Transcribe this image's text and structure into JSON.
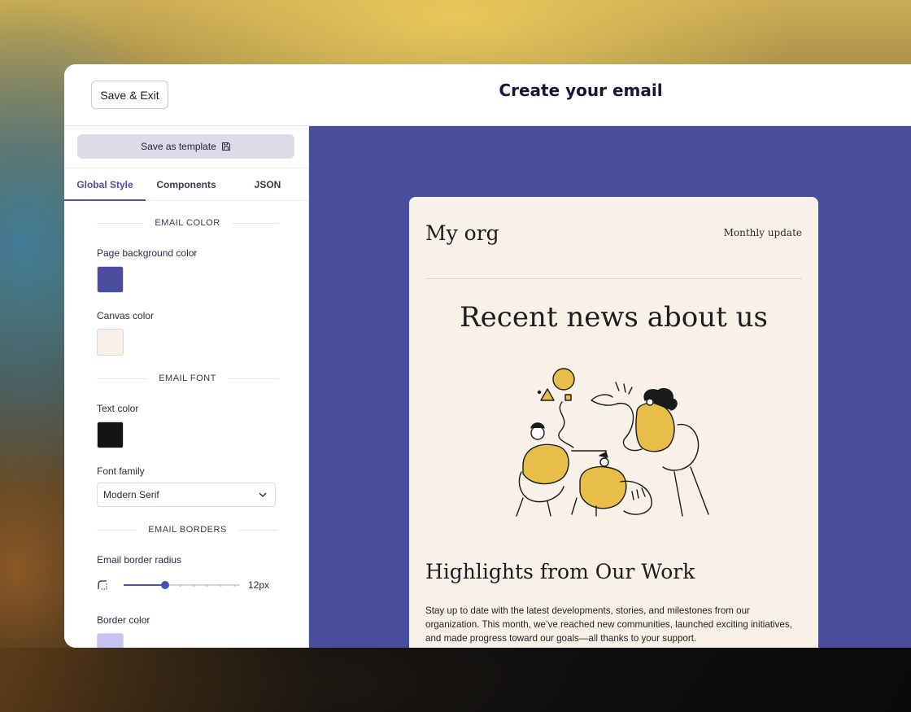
{
  "header": {
    "save_exit_label": "Save & Exit",
    "title": "Create your email"
  },
  "sidebar": {
    "save_template_label": "Save as template",
    "tabs": [
      {
        "label": "Global Style",
        "active": true
      },
      {
        "label": "Components",
        "active": false
      },
      {
        "label": "JSON",
        "active": false
      }
    ],
    "sections": {
      "color": "EMAIL COLOR",
      "font": "EMAIL FONT",
      "borders": "EMAIL BORDERS"
    },
    "fields": {
      "page_bg_label": "Page background color",
      "page_bg_value": "#4a4c9e",
      "canvas_label": "Canvas color",
      "canvas_value": "#f8f1e8",
      "text_color_label": "Text color",
      "text_color_value": "#141414",
      "font_family_label": "Font family",
      "font_family_value": "Modern Serif",
      "border_radius_label": "Email border radius",
      "border_radius_value": "12px",
      "border_radius_fraction": 0.36,
      "border_color_label": "Border color",
      "border_color_value": "#c5c4f3"
    }
  },
  "email": {
    "org_name": "My org",
    "tagline": "Monthly update",
    "headline": "Recent news about us",
    "subheadline": "Highlights from Our Work",
    "body": "Stay up to date with the latest developments, stories, and milestones from our organization. This month, we’ve reached new communities, launched exciting initiatives, and made progress toward our goals—all thanks to your support."
  },
  "colors": {
    "accent": "#4b4fb0",
    "illustration_yellow": "#e8bd4a"
  }
}
